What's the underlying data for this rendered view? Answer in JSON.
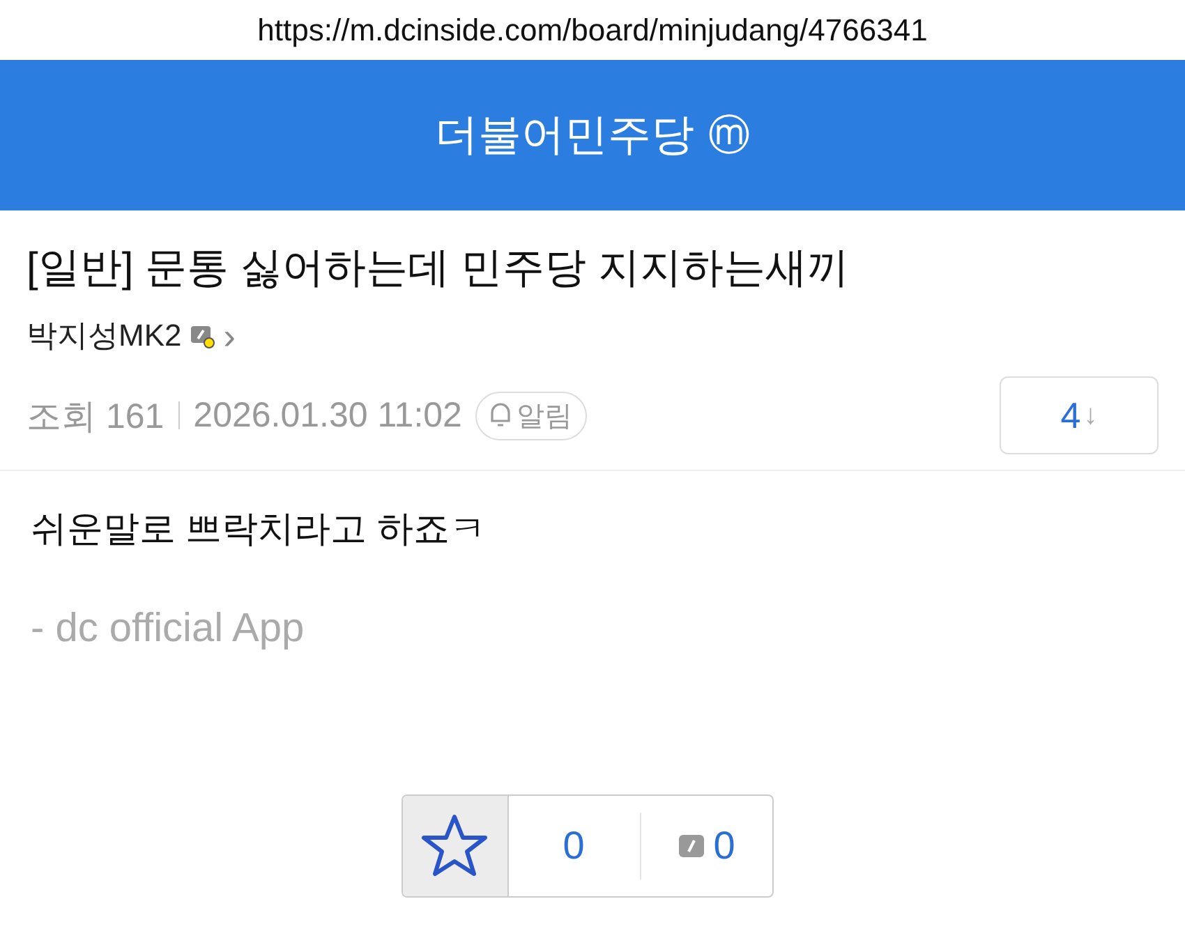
{
  "url_bar": {
    "url": "https://m.dcinside.com/board/minjudang/4766341"
  },
  "header": {
    "title": "더불어민주당",
    "badge": "ⓜ"
  },
  "post": {
    "title": "[일반] 문통 싫어하는데 민주당 지지하는새끼",
    "author": "박지성MK2",
    "author_arrow": "›",
    "views": "조회 161",
    "date": "2026.01.30 11:02",
    "alert": "알림",
    "comments": "4",
    "comments_arrow": "↓"
  },
  "body": {
    "text": "쉬운말로 쁘락치라고 하죠ㅋ",
    "signature": "- dc official App"
  },
  "reco": {
    "upvotes": "0",
    "fixed_votes": "0"
  }
}
